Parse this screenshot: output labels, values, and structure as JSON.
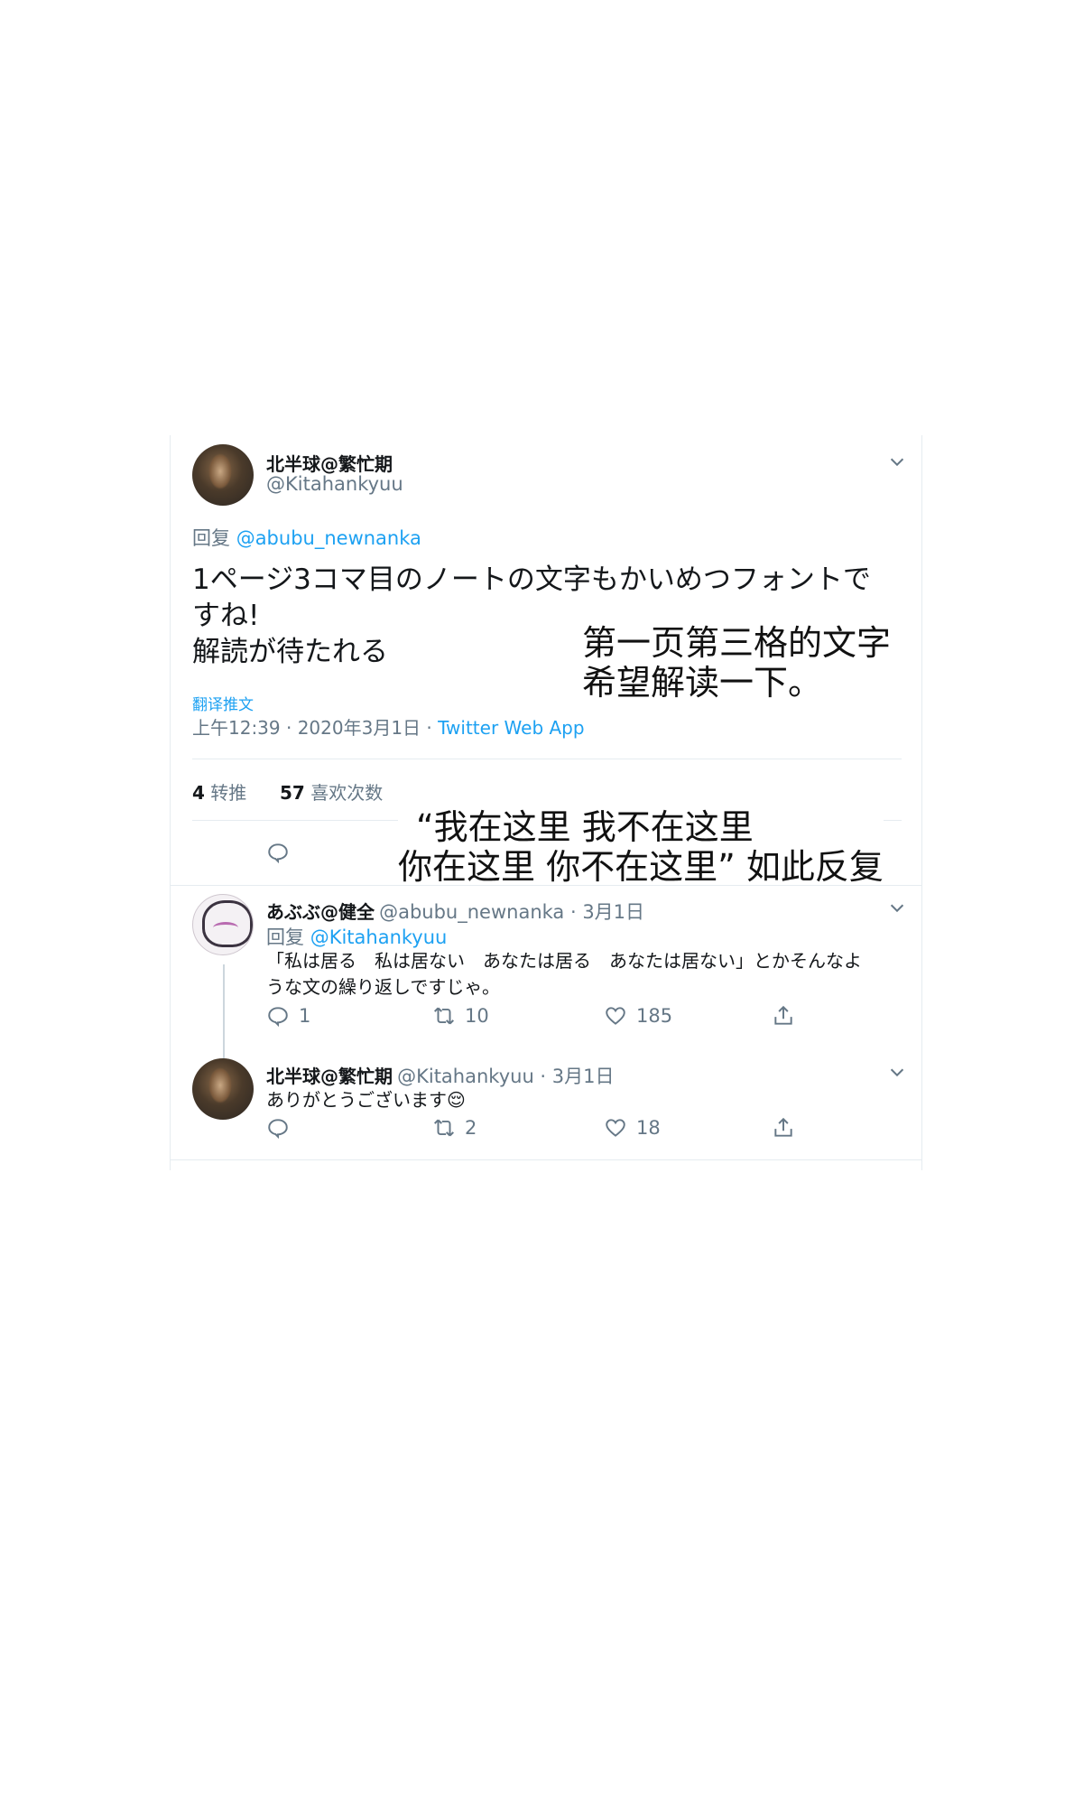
{
  "main_tweet": {
    "display_name": "北半球@繁忙期",
    "handle": "@Kitahankyuu",
    "reply_prefix": "回复",
    "reply_to": "@abubu_newnanka",
    "text_line1": "1ページ3コマ目のノートの文字もかいめつフォントで",
    "text_line2": "すね!",
    "text_line3": "解読が待たれる",
    "translate_label": "翻译推文",
    "time": "上午12:39 · 2020年3月1日 · ",
    "source": "Twitter Web App",
    "retweets_count": "4",
    "retweets_label": "转推",
    "likes_count": "57",
    "likes_label": "喜欢次数"
  },
  "overlays": {
    "note1_line1": "第一页第三格的文字",
    "note1_line2": "希望解读一下。",
    "note2_line1": "“我在这里 我不在这里",
    "note2_line2": "你在这里  你不在这里” 如此反复"
  },
  "reply1": {
    "display_name": "あぶぶ@健全",
    "handle_time": "@abubu_newnanka · 3月1日",
    "reply_prefix": "回复",
    "reply_to": "@Kitahankyuu",
    "text_line1": "「私は居る　私は居ない　あなたは居る　あなたは居ない」とかそんなよ",
    "text_line2": "うな文の繰り返しですじゃ。",
    "reply_count": "1",
    "retweet_count": "10",
    "like_count": "185"
  },
  "reply2": {
    "display_name": "北半球@繁忙期",
    "handle_time": "@Kitahankyuu · 3月1日",
    "text": "ありがとうございます",
    "emoji": "😌",
    "retweet_count": "2",
    "like_count": "18"
  },
  "icons": {
    "chevron": "chevron-down-icon",
    "reply": "reply-icon",
    "retweet": "retweet-icon",
    "like": "heart-icon",
    "share": "share-icon"
  },
  "colors": {
    "link": "#1da1f2",
    "secondary_text": "#657786",
    "primary_text": "#14171a",
    "divider": "#e6ecf0"
  }
}
